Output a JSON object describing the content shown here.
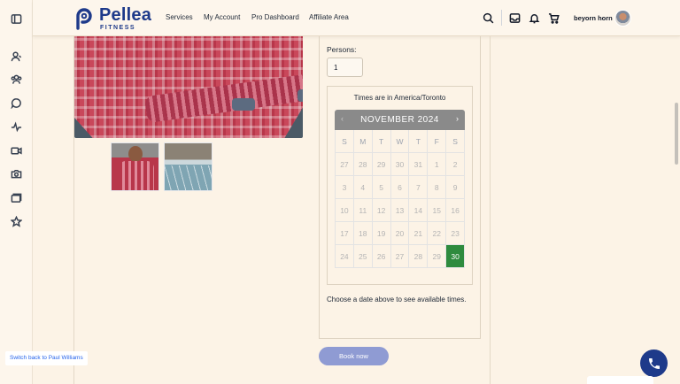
{
  "sidebar": {
    "items": [
      {
        "icon": "sidebar-toggle-icon"
      },
      {
        "icon": "user-icon"
      },
      {
        "icon": "users-icon"
      },
      {
        "icon": "chat-icon"
      },
      {
        "icon": "activity-icon"
      },
      {
        "icon": "video-icon"
      },
      {
        "icon": "camera-icon"
      },
      {
        "icon": "folders-icon"
      },
      {
        "icon": "star-icon"
      }
    ]
  },
  "header": {
    "logo_brand": "Pellea",
    "logo_sub": "FITNESS",
    "nav": [
      "Services",
      "My Account",
      "Pro Dashboard",
      "Affiliate Area"
    ],
    "icons": [
      "search-icon",
      "inbox-icon",
      "bell-icon",
      "cart-icon"
    ],
    "username": "beyorn horn"
  },
  "booking": {
    "persons_label": "Persons:",
    "persons_value": "1",
    "timezone_text": "Times are in America/Toronto",
    "calendar": {
      "month_title": "NOVEMBER 2024",
      "prev": "‹",
      "next": "›",
      "weekdays": [
        "S",
        "M",
        "T",
        "W",
        "T",
        "F",
        "S"
      ],
      "weeks": [
        [
          "27",
          "28",
          "29",
          "30",
          "31",
          "1",
          "2"
        ],
        [
          "3",
          "4",
          "5",
          "6",
          "7",
          "8",
          "9"
        ],
        [
          "10",
          "11",
          "12",
          "13",
          "14",
          "15",
          "16"
        ],
        [
          "17",
          "18",
          "19",
          "20",
          "21",
          "22",
          "23"
        ],
        [
          "24",
          "25",
          "26",
          "27",
          "28",
          "29",
          "30"
        ]
      ],
      "selected": "30",
      "selected_color": "#2e8b3e"
    },
    "hint": "Choose a date above to see available times.",
    "book_label": "Book now"
  },
  "switch_back": "Switch back to Paul Williams",
  "colors": {
    "background": "#fcf3e6",
    "brand": "#1e3a8a",
    "book_button": "#8f9bd3"
  }
}
